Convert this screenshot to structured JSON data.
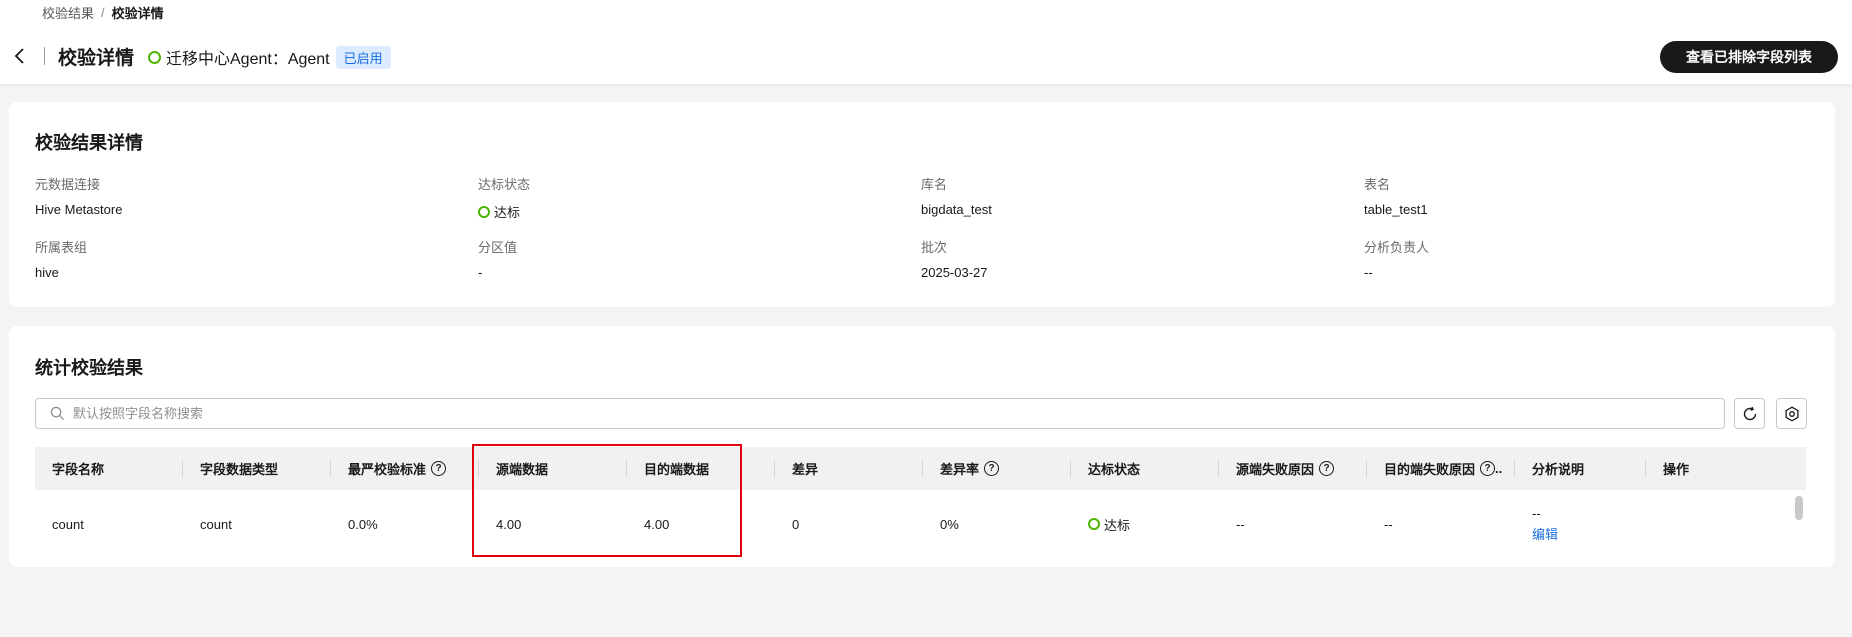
{
  "breadcrumb": {
    "parent": "校验结果",
    "separator": "/",
    "current": "校验详情"
  },
  "header": {
    "title": "校验详情",
    "agent_text": "迁移中心Agent：Agent",
    "agent_badge": "已启用",
    "primary_button": "查看已排除字段列表"
  },
  "detail": {
    "title": "校验结果详情",
    "fields": [
      {
        "label": "元数据连接",
        "value": "Hive Metastore"
      },
      {
        "label": "达标状态",
        "value": "达标"
      },
      {
        "label": "库名",
        "value": "bigdata_test"
      },
      {
        "label": "表名",
        "value": "table_test1"
      },
      {
        "label": "所属表组",
        "value": "hive"
      },
      {
        "label": "分区值",
        "value": "-"
      },
      {
        "label": "批次",
        "value": "2025-03-27"
      },
      {
        "label": "分析负责人",
        "value": "--"
      }
    ]
  },
  "stats": {
    "title": "统计校验结果",
    "search_placeholder": "默认按照字段名称搜索",
    "columns": [
      "字段名称",
      "字段数据类型",
      "最严校验标准",
      "源端数据",
      "目的端数据",
      "差异",
      "差异率",
      "达标状态",
      "源端失败原因",
      "目的端失败原因",
      "分析说明",
      "操作"
    ],
    "rows": [
      {
        "name": "count",
        "type": "count",
        "strictest": "0.0%",
        "source": "4.00",
        "target": "4.00",
        "diff": "0",
        "diff_rate": "0%",
        "status": "达标",
        "source_fail": "--",
        "target_fail": "--",
        "analysis": "--",
        "analysis_action": "编辑",
        "operation": ""
      }
    ]
  },
  "colors": {
    "success": "#4fb500",
    "link": "#1a6fe0",
    "highlight": "#e0000b",
    "primary_button": "#191919"
  }
}
